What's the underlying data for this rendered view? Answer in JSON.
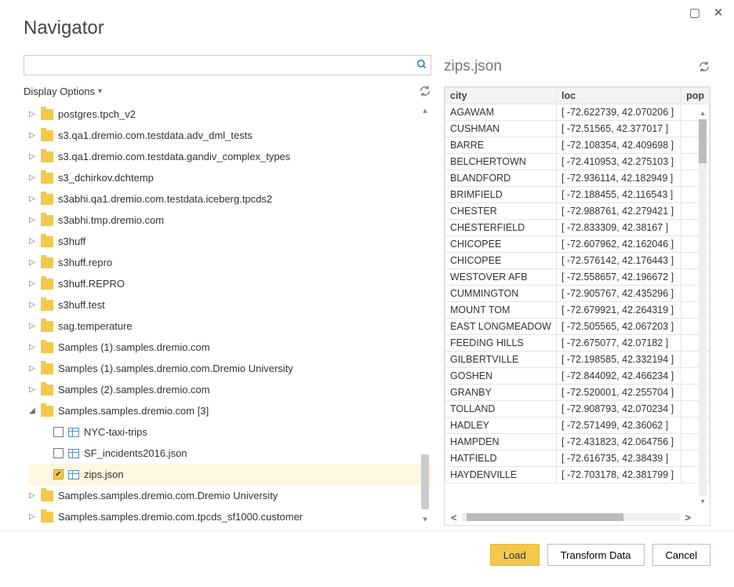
{
  "window": {
    "title": "Navigator"
  },
  "search": {
    "value": "",
    "placeholder": ""
  },
  "displayOptions": {
    "label": "Display Options"
  },
  "tree": {
    "items": [
      {
        "label": "postgres.tpch_v2",
        "expanded": false
      },
      {
        "label": "s3.qa1.dremio.com.testdata.adv_dml_tests",
        "expanded": false
      },
      {
        "label": "s3.qa1.dremio.com.testdata.gandiv_complex_types",
        "expanded": false
      },
      {
        "label": "s3_dchirkov.dchtemp",
        "expanded": false
      },
      {
        "label": "s3abhi.qa1.dremio.com.testdata.iceberg.tpcds2",
        "expanded": false
      },
      {
        "label": "s3abhi.tmp.dremio.com",
        "expanded": false
      },
      {
        "label": "s3huff",
        "expanded": false
      },
      {
        "label": "s3huff.repro",
        "expanded": false
      },
      {
        "label": "s3huff.REPRO",
        "expanded": false
      },
      {
        "label": "s3huff.test",
        "expanded": false
      },
      {
        "label": "sag.temperature",
        "expanded": false
      },
      {
        "label": "Samples (1).samples.dremio.com",
        "expanded": false
      },
      {
        "label": "Samples (1).samples.dremio.com.Dremio University",
        "expanded": false
      },
      {
        "label": "Samples (2).samples.dremio.com",
        "expanded": false
      },
      {
        "label": "Samples.samples.dremio.com [3]",
        "expanded": true,
        "children": [
          {
            "label": "NYC-taxi-trips",
            "checked": false,
            "selected": false
          },
          {
            "label": "SF_incidents2016.json",
            "checked": false,
            "selected": false
          },
          {
            "label": "zips.json",
            "checked": true,
            "selected": true
          }
        ]
      },
      {
        "label": "Samples.samples.dremio.com.Dremio University",
        "expanded": false
      },
      {
        "label": "Samples.samples.dremio.com.tpcds_sf1000.customer",
        "expanded": false
      }
    ]
  },
  "preview": {
    "title": "zips.json",
    "columns": [
      {
        "key": "city",
        "label": "city"
      },
      {
        "key": "loc",
        "label": "loc"
      },
      {
        "key": "pop",
        "label": "pop"
      }
    ],
    "rows": [
      {
        "city": "AGAWAM",
        "loc": "[ -72.622739, 42.070206 ]",
        "pop": ""
      },
      {
        "city": "CUSHMAN",
        "loc": "[ -72.51565, 42.377017 ]",
        "pop": ""
      },
      {
        "city": "BARRE",
        "loc": "[ -72.108354, 42.409698 ]",
        "pop": ""
      },
      {
        "city": "BELCHERTOWN",
        "loc": "[ -72.410953, 42.275103 ]",
        "pop": ""
      },
      {
        "city": "BLANDFORD",
        "loc": "[ -72.936114, 42.182949 ]",
        "pop": ""
      },
      {
        "city": "BRIMFIELD",
        "loc": "[ -72.188455, 42.116543 ]",
        "pop": ""
      },
      {
        "city": "CHESTER",
        "loc": "[ -72.988761, 42.279421 ]",
        "pop": ""
      },
      {
        "city": "CHESTERFIELD",
        "loc": "[ -72.833309, 42.38167 ]",
        "pop": ""
      },
      {
        "city": "CHICOPEE",
        "loc": "[ -72.607962, 42.162046 ]",
        "pop": ""
      },
      {
        "city": "CHICOPEE",
        "loc": "[ -72.576142, 42.176443 ]",
        "pop": ""
      },
      {
        "city": "WESTOVER AFB",
        "loc": "[ -72.558657, 42.196672 ]",
        "pop": ""
      },
      {
        "city": "CUMMINGTON",
        "loc": "[ -72.905767, 42.435296 ]",
        "pop": ""
      },
      {
        "city": "MOUNT TOM",
        "loc": "[ -72.679921, 42.264319 ]",
        "pop": ""
      },
      {
        "city": "EAST LONGMEADOW",
        "loc": "[ -72.505565, 42.067203 ]",
        "pop": ""
      },
      {
        "city": "FEEDING HILLS",
        "loc": "[ -72.675077, 42.07182 ]",
        "pop": ""
      },
      {
        "city": "GILBERTVILLE",
        "loc": "[ -72.198585, 42.332194 ]",
        "pop": ""
      },
      {
        "city": "GOSHEN",
        "loc": "[ -72.844092, 42.466234 ]",
        "pop": ""
      },
      {
        "city": "GRANBY",
        "loc": "[ -72.520001, 42.255704 ]",
        "pop": ""
      },
      {
        "city": "TOLLAND",
        "loc": "[ -72.908793, 42.070234 ]",
        "pop": ""
      },
      {
        "city": "HADLEY",
        "loc": "[ -72.571499, 42.36062 ]",
        "pop": ""
      },
      {
        "city": "HAMPDEN",
        "loc": "[ -72.431823, 42.064756 ]",
        "pop": ""
      },
      {
        "city": "HATFIELD",
        "loc": "[ -72.616735, 42.38439 ]",
        "pop": ""
      },
      {
        "city": "HAYDENVILLE",
        "loc": "[ -72.703178, 42.381799 ]",
        "pop": ""
      }
    ]
  },
  "footer": {
    "load": "Load",
    "transform": "Transform Data",
    "cancel": "Cancel"
  }
}
